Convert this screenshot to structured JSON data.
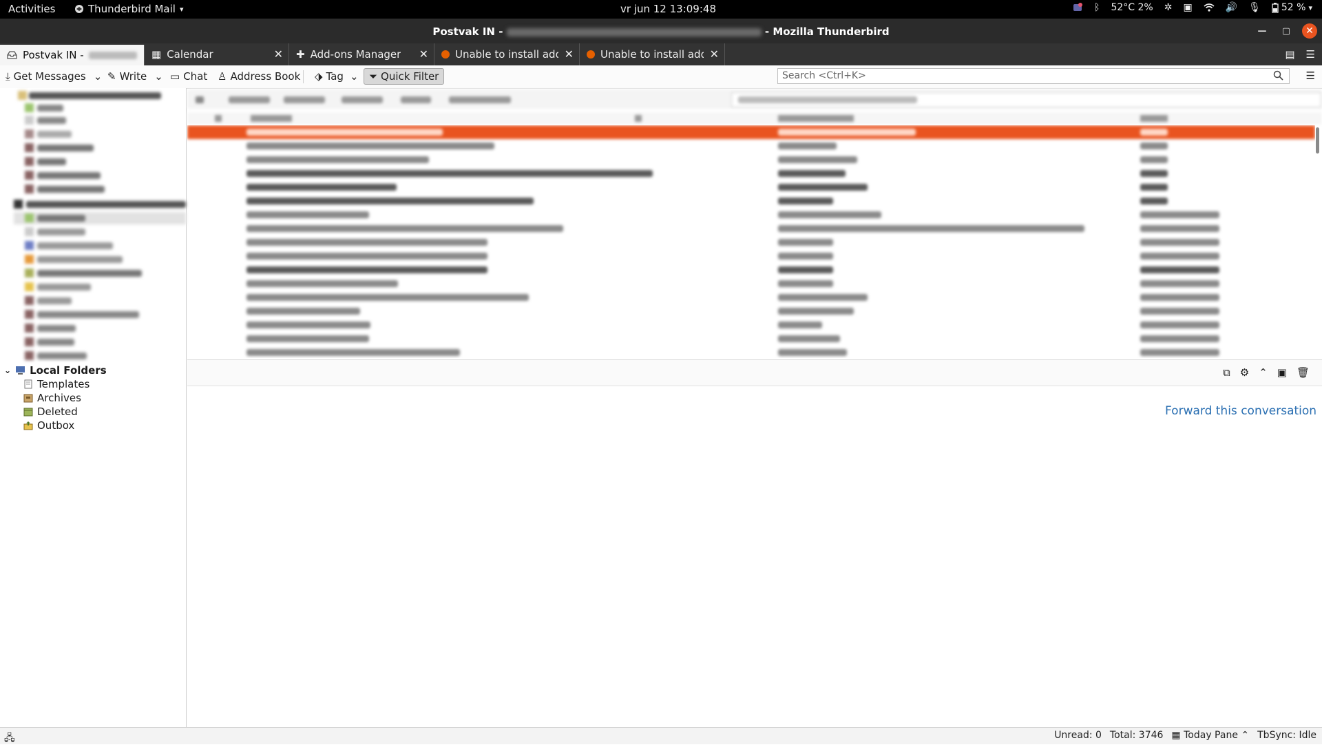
{
  "topbar": {
    "activities": "Activities",
    "app_menu": "Thunderbird Mail",
    "clock": "vr jun 12  13:09:48",
    "temp": "52°C 2%",
    "battery": "52 %"
  },
  "window": {
    "title_left": "Postvak IN - ",
    "title_right": " - Mozilla Thunderbird"
  },
  "tabs": [
    {
      "label": "Postvak IN - "
    },
    {
      "label": "Calendar"
    },
    {
      "label": "Add-ons Manager"
    },
    {
      "label": "Unable to install add-o"
    },
    {
      "label": "Unable to install add-o"
    }
  ],
  "toolbar": {
    "get_messages": "Get Messages",
    "write": "Write",
    "chat": "Chat",
    "address_book": "Address Book",
    "tag": "Tag",
    "quick_filter": "Quick Filter",
    "search_placeholder": "Search <Ctrl+K>"
  },
  "folders": {
    "local_root": "Local Folders",
    "items": [
      {
        "label": "Templates"
      },
      {
        "label": "Archives"
      },
      {
        "label": "Deleted"
      },
      {
        "label": "Outbox"
      }
    ]
  },
  "preview": {
    "forward_link": "Forward this conversation"
  },
  "statusbar": {
    "unread": "Unread: 0",
    "total": "Total: 3746",
    "today_pane": "Today Pane",
    "tbsync": "TbSync: Idle"
  },
  "colors": {
    "accent": "#e95420",
    "link": "#2a6fb2"
  }
}
